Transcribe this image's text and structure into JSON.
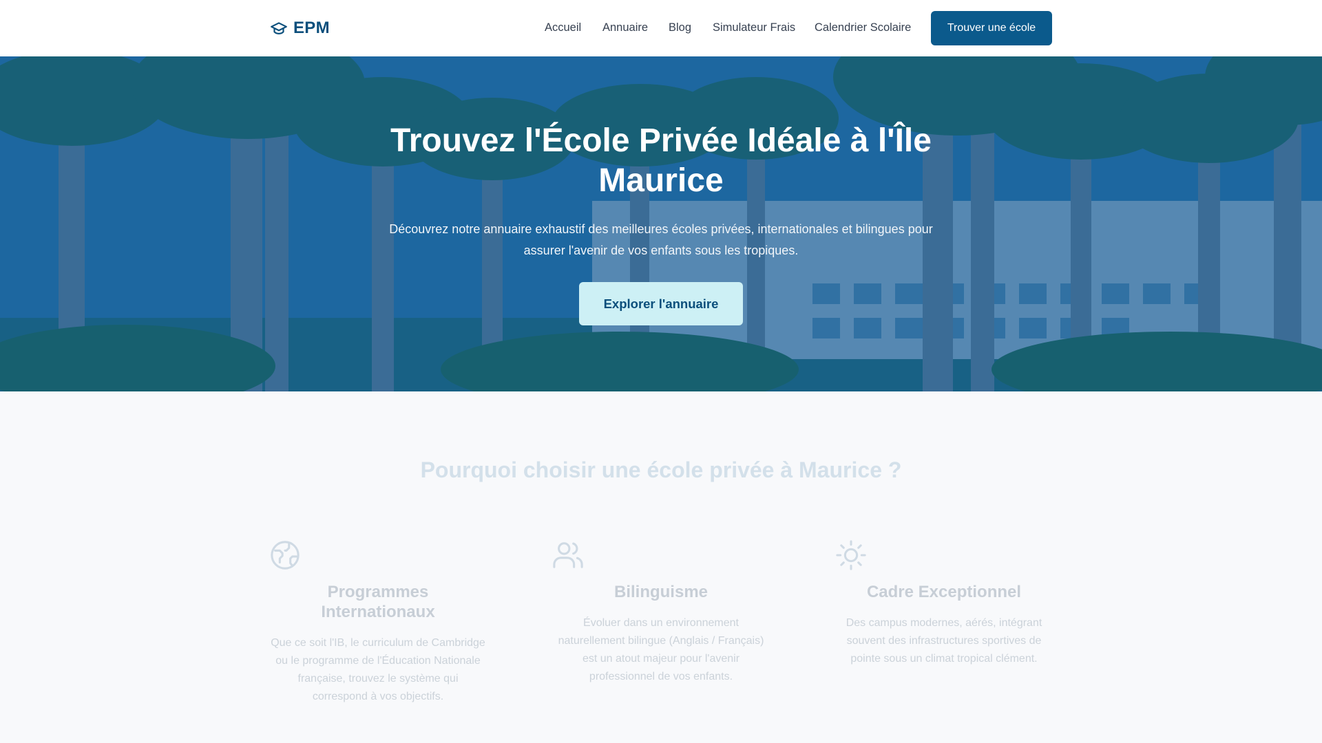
{
  "navbar": {
    "brand": "EPM",
    "brand_icon": "graduation-cap-icon",
    "links": [
      "Accueil",
      "Annuaire",
      "Blog",
      "Simulateur Frais",
      "Calendrier Scolaire"
    ],
    "cta_label": "Trouver une école"
  },
  "hero": {
    "title": "Trouvez l'École Privée Idéale à l'Île Maurice",
    "subtitle": "Découvrez notre annuaire exhaustif des meilleures écoles privées, internationales et bilingues pour assurer l'avenir de vos enfants sous les tropiques.",
    "button_label": "Explorer l'annuaire"
  },
  "features": {
    "title": "Pourquoi choisir une école privée à Maurice ?",
    "items": [
      {
        "icon": "globe-icon",
        "title": "Programmes Internationaux",
        "text": "Que ce soit l'IB, le curriculum de Cambridge ou le programme de l'Éducation Nationale française, trouvez le système qui correspond à vos objectifs."
      },
      {
        "icon": "users-icon",
        "title": "Bilinguisme",
        "text": "Évoluer dans un environnement naturellement bilingue (Anglais / Français) est un atout majeur pour l'avenir professionnel de vos enfants."
      },
      {
        "icon": "sun-icon",
        "title": "Cadre Exceptionnel",
        "text": "Des campus modernes, aérés, intégrant souvent des infrastructures sportives de pointe sous un climat tropical clément."
      }
    ]
  },
  "colors": {
    "primary": "#0b5a8c",
    "brand": "#0b4f7c",
    "hero_overlay": "#0c508c",
    "hero_button_bg": "#cdf0f5"
  }
}
